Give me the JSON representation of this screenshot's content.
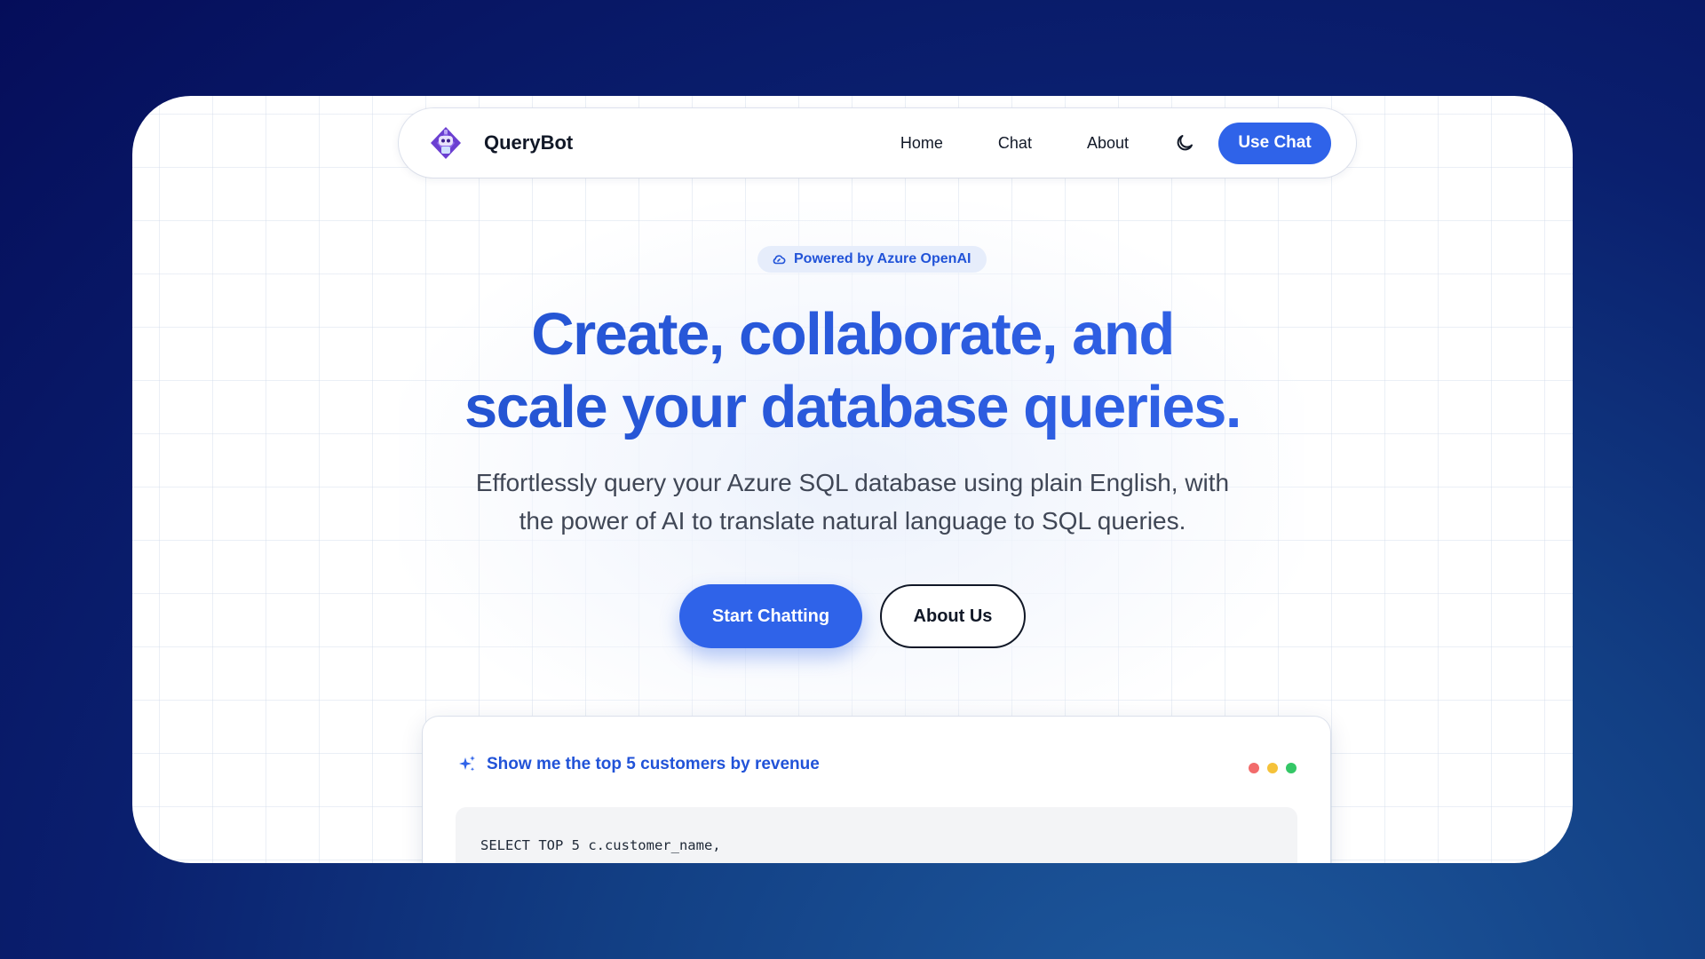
{
  "nav": {
    "brand": "QueryBot",
    "links": [
      "Home",
      "Chat",
      "About"
    ],
    "cta": "Use Chat"
  },
  "hero": {
    "badge": "Powered by Azure OpenAI",
    "headline_line1": "Create, collaborate, and",
    "headline_line2": "scale your database queries.",
    "subtitle_line1": "Effortlessly query your Azure SQL database using plain English, with",
    "subtitle_line2": "the power of AI to translate natural language to SQL queries.",
    "primary_cta": "Start Chatting",
    "secondary_cta": "About Us"
  },
  "demo": {
    "prompt": "Show me the top 5 customers by revenue",
    "code_line1": "SELECT TOP 5 c.customer_name,"
  },
  "colors": {
    "accent": "#2f63e9",
    "dot_red": "#f26b6b",
    "dot_yellow": "#f5c23a",
    "dot_green": "#34c766"
  },
  "icons": {
    "logo": "robot-logo-icon",
    "theme_toggle": "moon-icon",
    "badge": "cloud-icon",
    "prompt": "sparkles-icon"
  }
}
